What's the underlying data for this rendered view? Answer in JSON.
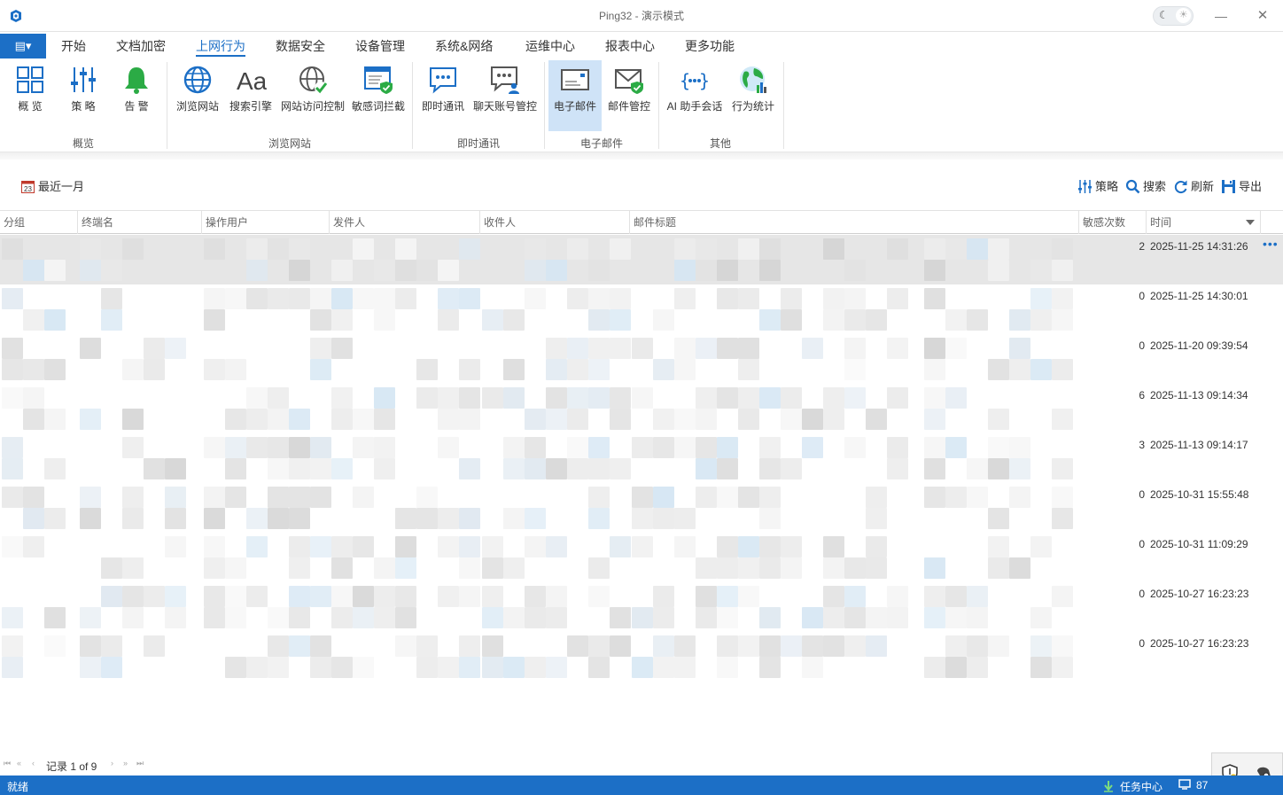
{
  "window": {
    "title": "Ping32 - 演示模式",
    "minimize_glyph": "—",
    "close_glyph": "✕",
    "theme_icons": {
      "dark": "moon-icon",
      "light": "sun-icon"
    }
  },
  "menu": {
    "app_button_glyph": "▤▾",
    "tabs": [
      {
        "label": "开始"
      },
      {
        "label": "文档加密"
      },
      {
        "label": "上网行为",
        "active": true
      },
      {
        "label": "数据安全"
      },
      {
        "label": "设备管理"
      },
      {
        "label": "系统&网络"
      },
      {
        "label": "运维中心"
      },
      {
        "label": "报表中心"
      },
      {
        "label": "更多功能"
      }
    ]
  },
  "ribbon": {
    "buttons": [
      {
        "label": "概 览",
        "icon": "grid-icon"
      },
      {
        "label": "策 略",
        "icon": "sliders-icon"
      },
      {
        "label": "告 警",
        "icon": "bell-icon"
      },
      {
        "label": "浏览网站",
        "icon": "globe-icon"
      },
      {
        "label": "搜索引擎",
        "icon": "font-aa-icon"
      },
      {
        "label": "网站访问控制",
        "icon": "globe-check-icon"
      },
      {
        "label": "敏感词拦截",
        "icon": "browser-shield-icon"
      },
      {
        "label": "即时通讯",
        "icon": "chat-icon"
      },
      {
        "label": "聊天账号管控",
        "icon": "chat-user-icon"
      },
      {
        "label": "电子邮件",
        "icon": "envelope-icon",
        "selected": true
      },
      {
        "label": "邮件管控",
        "icon": "envelope-shield-icon"
      },
      {
        "label": "AI 助手会话",
        "icon": "ai-braces-icon"
      },
      {
        "label": "行为统计",
        "icon": "earth-stats-icon"
      }
    ],
    "groups": [
      {
        "label": "概览"
      },
      {
        "label": "浏览网站"
      },
      {
        "label": "即时通讯"
      },
      {
        "label": "电子邮件"
      },
      {
        "label": "其他"
      }
    ]
  },
  "toolbar": {
    "date_range": "最近一月",
    "date_icon": "calendar-icon",
    "policy": "策略",
    "search": "搜索",
    "refresh": "刷新",
    "export": "导出"
  },
  "grid": {
    "columns": [
      "分组",
      "终端名",
      "操作用户",
      "发件人",
      "收件人",
      "邮件标题",
      "敏感次数",
      "时间"
    ],
    "sort_column": "时间",
    "sort_direction": "desc",
    "rows": [
      {
        "sensitive_count": "2",
        "time": "2025-11-25 14:31:26",
        "selected": true
      },
      {
        "sensitive_count": "0",
        "time": "2025-11-25 14:30:01"
      },
      {
        "sensitive_count": "0",
        "time": "2025-11-20 09:39:54"
      },
      {
        "sensitive_count": "6",
        "time": "2025-11-13 09:14:34"
      },
      {
        "sensitive_count": "3",
        "time": "2025-11-13 09:14:17"
      },
      {
        "sensitive_count": "0",
        "time": "2025-10-31 15:55:48"
      },
      {
        "sensitive_count": "0",
        "time": "2025-10-31 11:09:29"
      },
      {
        "sensitive_count": "0",
        "time": "2025-10-27 16:23:23"
      },
      {
        "sensitive_count": "0",
        "time": "2025-10-27 16:23:23"
      }
    ],
    "row_more_glyph": "•••"
  },
  "pager": {
    "text": "记录 1 of 9",
    "first": "⏮",
    "prev_page": "«",
    "prev": "‹",
    "next": "›",
    "next_page": "»",
    "last": "⏭"
  },
  "statusbar": {
    "status": "就绪",
    "task_center": "任务中心",
    "extra": "87"
  },
  "colors": {
    "accent": "#1c6fc6",
    "ribbon_selected": "#cfe3f7",
    "row_selected": "#e6e6e6"
  }
}
